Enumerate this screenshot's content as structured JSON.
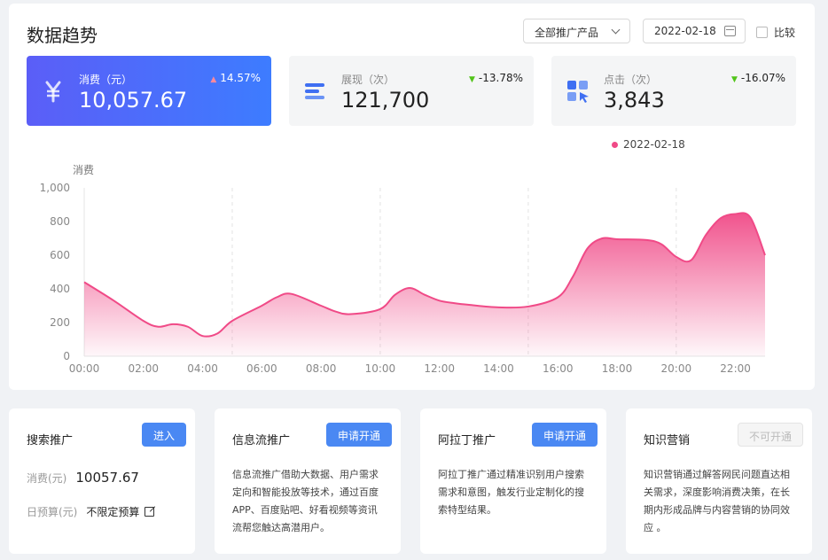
{
  "header": {
    "title": "数据趋势",
    "product_select": "全部推广产品",
    "date": "2022-02-18",
    "compare_label": "比较"
  },
  "stats": [
    {
      "label": "消费（元）",
      "value": "10,057.67",
      "change": "14.57%",
      "direction": "up",
      "icon": "yuan-icon"
    },
    {
      "label": "展现（次）",
      "value": "121,700",
      "change": "-13.78%",
      "direction": "down",
      "icon": "bars-icon"
    },
    {
      "label": "点击（次）",
      "value": "3,843",
      "change": "-16.07%",
      "direction": "down",
      "icon": "cursor-grid-icon"
    }
  ],
  "colors": {
    "accent": "#3d7cff",
    "series": "#f04a87",
    "up": "#f04a6e",
    "down": "#52c41a"
  },
  "chart_data": {
    "type": "area",
    "ylabel": "消费",
    "ylim": [
      0,
      1000
    ],
    "yticks": [
      "0",
      "200",
      "400",
      "600",
      "800",
      "1,000"
    ],
    "xticks": [
      "00:00",
      "02:00",
      "04:00",
      "06:00",
      "08:00",
      "10:00",
      "12:00",
      "14:00",
      "16:00",
      "18:00",
      "20:00",
      "22:00"
    ],
    "series": [
      {
        "name": "2022-02-18",
        "x": [
          0,
          1,
          2,
          2.5,
          3,
          3.5,
          4,
          4.5,
          5,
          6,
          6.5,
          7,
          8,
          8.5,
          9,
          10,
          10.5,
          11,
          11.5,
          12,
          12.5,
          13,
          14,
          15,
          16,
          16.5,
          17,
          17.5,
          18,
          19,
          19.5,
          20,
          20.5,
          21,
          21.5,
          22,
          22.5,
          23
        ],
        "y": [
          440,
          330,
          210,
          175,
          190,
          175,
          120,
          135,
          210,
          300,
          350,
          370,
          300,
          265,
          250,
          280,
          365,
          405,
          365,
          330,
          315,
          305,
          290,
          295,
          350,
          470,
          640,
          700,
          695,
          690,
          665,
          590,
          570,
          720,
          820,
          845,
          825,
          600
        ]
      }
    ]
  },
  "cards": [
    {
      "title": "搜索推广",
      "button": "进入",
      "spend_label": "消费(元)",
      "spend_value": "10057.67",
      "budget_label": "日预算(元)",
      "budget_value": "不限定预算"
    },
    {
      "title": "信息流推广",
      "button": "申请开通",
      "desc": "信息流推广借助大数据、用户需求定向和智能投放等技术，通过百度APP、百度贴吧、好看视频等资讯流帮您触达高潜用户。"
    },
    {
      "title": "阿拉丁推广",
      "button": "申请开通",
      "desc": "阿拉丁推广通过精准识别用户搜索需求和意图，触发行业定制化的搜索特型结果。"
    },
    {
      "title": "知识营销",
      "button": "不可开通",
      "desc": "知识营销通过解答网民问题直达相关需求，深度影响消费决策，在长期内形成品牌与内容营销的协同效应 。"
    }
  ]
}
